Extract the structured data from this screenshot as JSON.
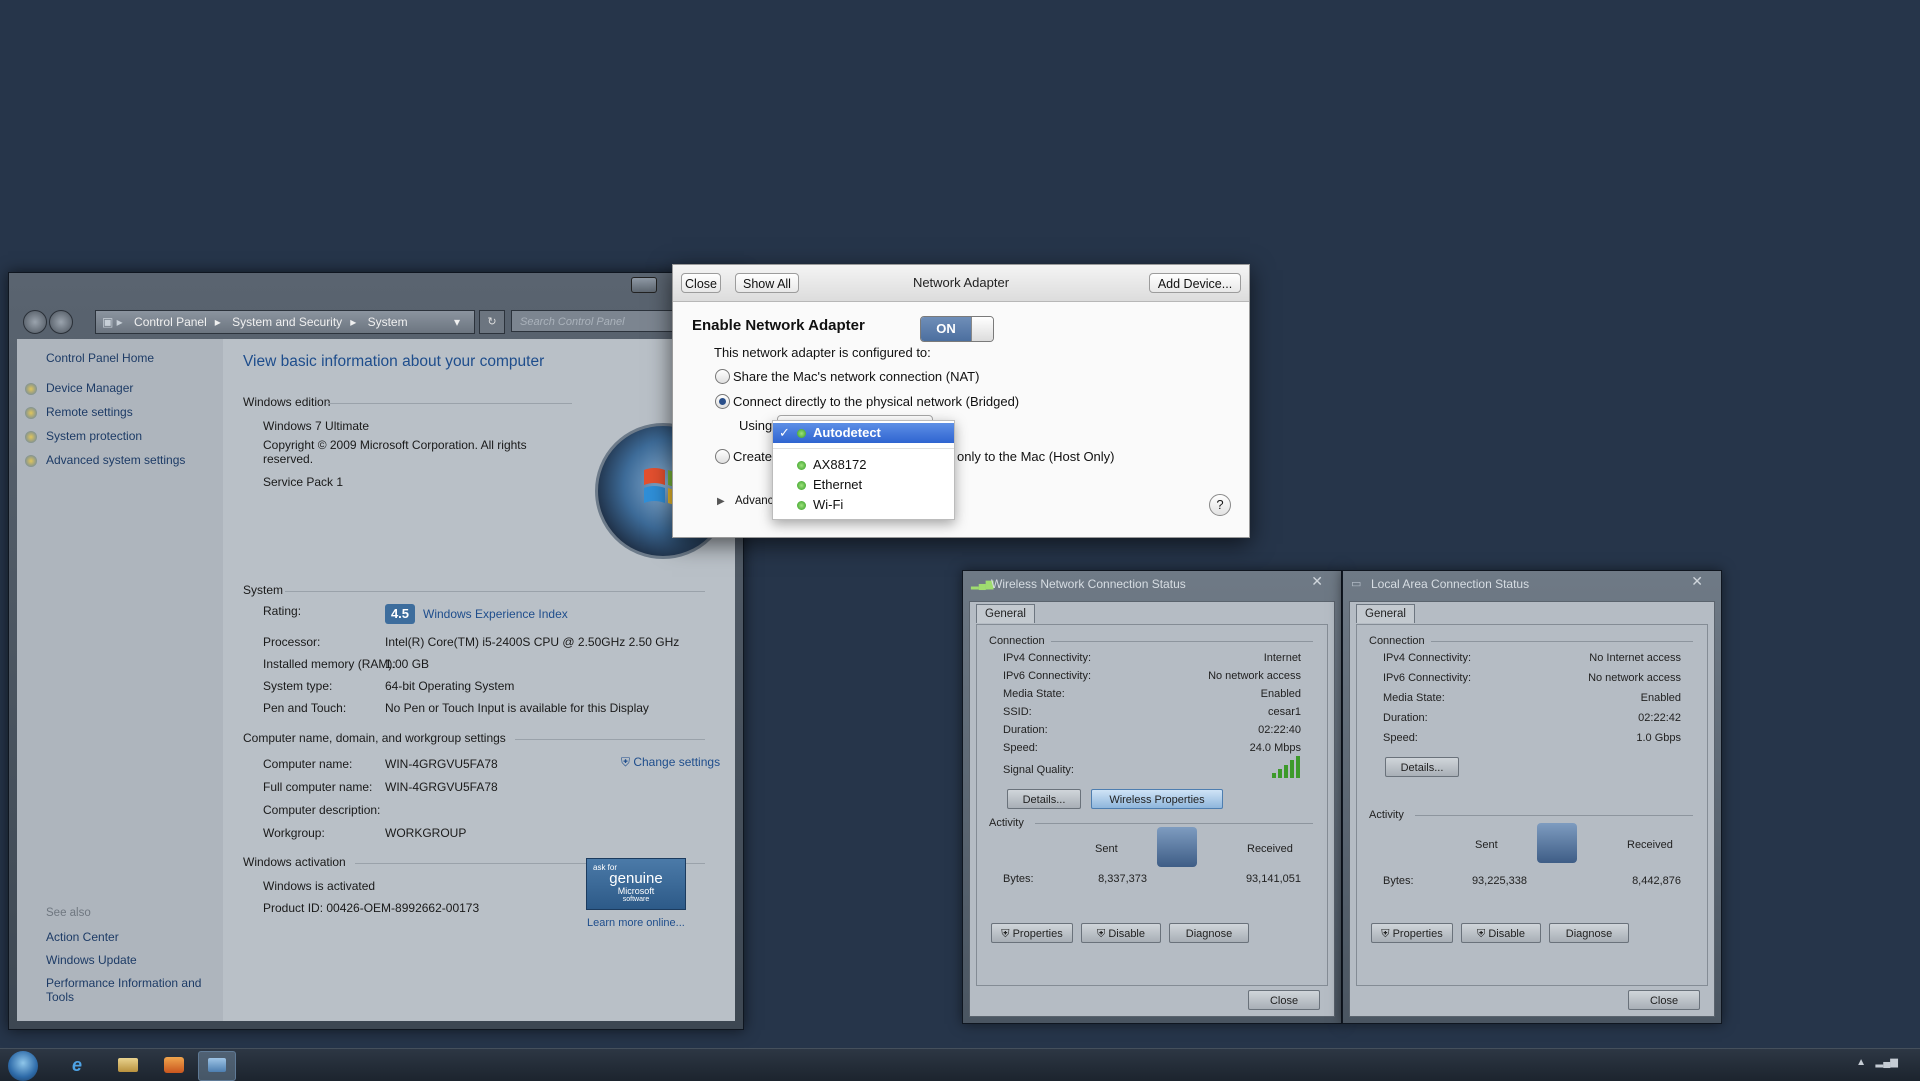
{
  "system_window": {
    "breadcrumb": [
      "Control Panel",
      "System and Security",
      "System"
    ],
    "search_placeholder": "Search Control Panel",
    "left_pane": {
      "home": "Control Panel Home",
      "links": [
        "Device Manager",
        "Remote settings",
        "System protection",
        "Advanced system settings"
      ],
      "see_also_title": "See also",
      "see_also": [
        "Action Center",
        "Windows Update",
        "Performance Information and Tools"
      ]
    },
    "title": "View basic information about your computer",
    "windows_edition": {
      "heading": "Windows edition",
      "edition": "Windows 7 Ultimate",
      "copyright": "Copyright © 2009 Microsoft Corporation.  All rights reserved.",
      "service_pack": "Service Pack 1"
    },
    "system": {
      "heading": "System",
      "rating_label": "Rating:",
      "rating_score": "4.5",
      "rating_link": "Windows Experience Index",
      "rows": [
        {
          "label": "Processor:",
          "value": "Intel(R) Core(TM) i5-2400S CPU @ 2.50GHz   2.50 GHz"
        },
        {
          "label": "Installed memory (RAM):",
          "value": "1.00 GB"
        },
        {
          "label": "System type:",
          "value": "64-bit Operating System"
        },
        {
          "label": "Pen and Touch:",
          "value": "No Pen or Touch Input is available for this Display"
        }
      ]
    },
    "computer_name": {
      "heading": "Computer name, domain, and workgroup settings",
      "change_settings": "Change settings",
      "rows": [
        {
          "label": "Computer name:",
          "value": "WIN-4GRGVU5FA78"
        },
        {
          "label": "Full computer name:",
          "value": "WIN-4GRGVU5FA78"
        },
        {
          "label": "Computer description:",
          "value": ""
        },
        {
          "label": "Workgroup:",
          "value": "WORKGROUP"
        }
      ]
    },
    "activation": {
      "heading": "Windows activation",
      "status": "Windows is activated",
      "product_id": "Product ID: 00426-OEM-8992662-00173",
      "genuine_line1": "ask for",
      "genuine_line2": "genuine",
      "genuine_line3": "Microsoft",
      "genuine_line4": "software",
      "learn_more": "Learn more online..."
    }
  },
  "network_adapter": {
    "close": "Close",
    "show_all": "Show All",
    "title": "Network Adapter",
    "add_device": "Add Device...",
    "enable_label": "Enable Network Adapter",
    "toggle": "ON",
    "configured_to": "This network adapter is configured to:",
    "option_nat": "Share the Mac's network connection (NAT)",
    "option_bridged": "Connect directly to the physical network (Bridged)",
    "using_label": "Using",
    "option_host_prefix": "Create",
    "option_host_suffix": "only to the Mac (Host Only)",
    "advanced": "Advanc",
    "help": "?",
    "dropdown": {
      "check": "✓",
      "options": [
        "Autodetect",
        "AX88172",
        "Ethernet",
        "Wi-Fi"
      ],
      "selected": "Autodetect"
    }
  },
  "wireless_status": {
    "title": "Wireless Network Connection Status",
    "tab": "General",
    "connection_heading": "Connection",
    "rows": [
      {
        "label": "IPv4 Connectivity:",
        "value": "Internet"
      },
      {
        "label": "IPv6 Connectivity:",
        "value": "No network access"
      },
      {
        "label": "Media State:",
        "value": "Enabled"
      },
      {
        "label": "SSID:",
        "value": "cesar1"
      },
      {
        "label": "Duration:",
        "value": "02:22:40"
      },
      {
        "label": "Speed:",
        "value": "24.0 Mbps"
      }
    ],
    "signal_label": "Signal Quality:",
    "details": "Details...",
    "wireless_properties": "Wireless Properties",
    "activity_heading": "Activity",
    "sent": "Sent",
    "received": "Received",
    "bytes_label": "Bytes:",
    "bytes_sent": "8,337,373",
    "bytes_received": "93,141,051",
    "properties": "Properties",
    "disable": "Disable",
    "diagnose": "Diagnose",
    "close": "Close"
  },
  "lan_status": {
    "title": "Local Area Connection Status",
    "tab": "General",
    "connection_heading": "Connection",
    "rows": [
      {
        "label": "IPv4 Connectivity:",
        "value": "No Internet access"
      },
      {
        "label": "IPv6 Connectivity:",
        "value": "No network access"
      },
      {
        "label": "Media State:",
        "value": "Enabled"
      },
      {
        "label": "Duration:",
        "value": "02:22:42"
      },
      {
        "label": "Speed:",
        "value": "1.0 Gbps"
      }
    ],
    "details": "Details...",
    "activity_heading": "Activity",
    "sent": "Sent",
    "received": "Received",
    "bytes_label": "Bytes:",
    "bytes_sent": "93,225,338",
    "bytes_received": "8,442,876",
    "properties": "Properties",
    "disable": "Disable",
    "diagnose": "Diagnose",
    "close": "Close"
  },
  "colors": {
    "desktop": "#26354a",
    "link": "#1e4d8c",
    "selection": "#2f64d0"
  }
}
